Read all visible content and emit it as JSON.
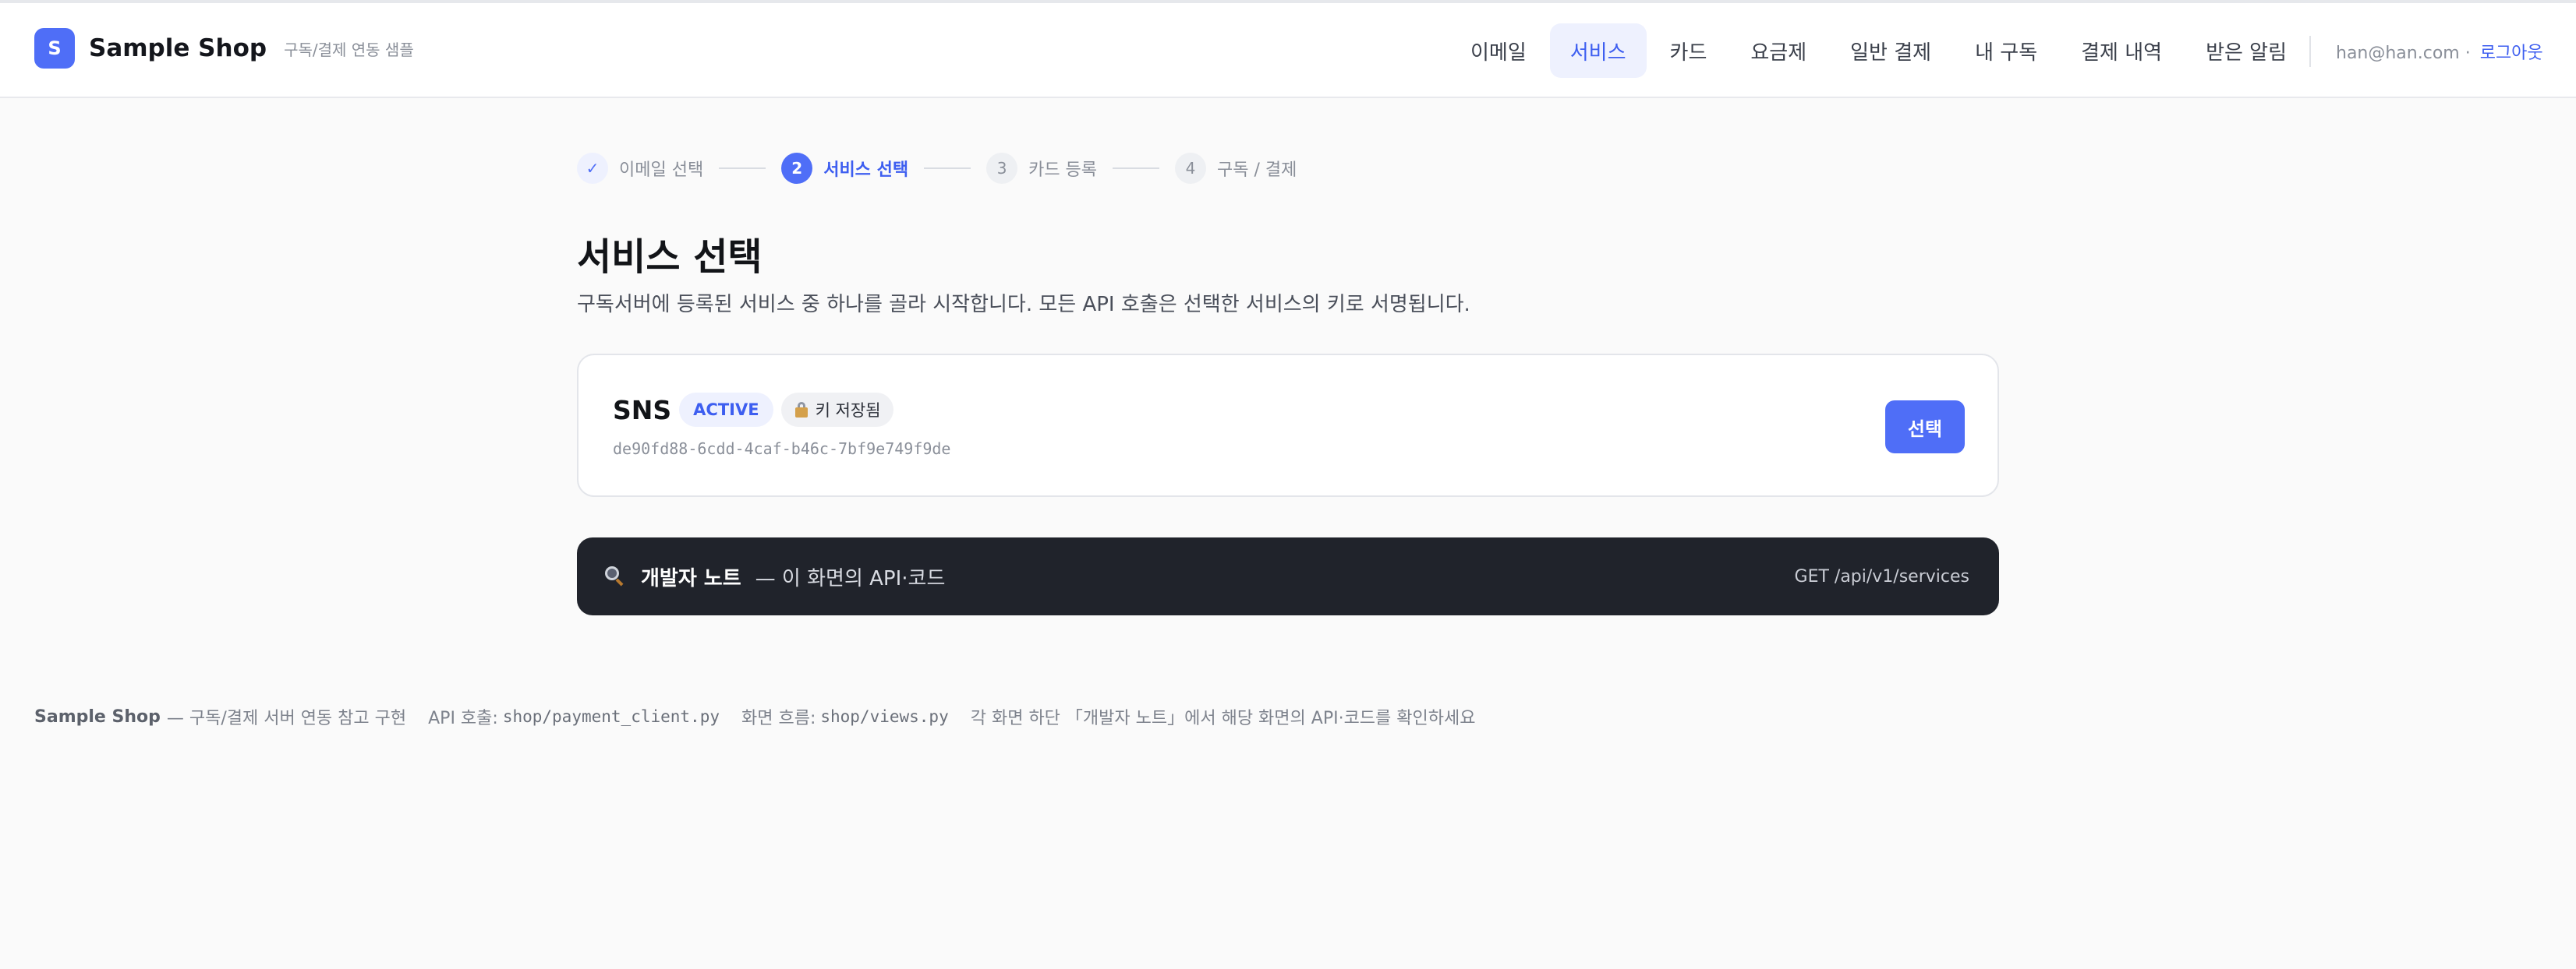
{
  "brand": {
    "logo_letter": "S",
    "name": "Sample Shop",
    "subtitle": "구독/결제 연동 샘플"
  },
  "nav": {
    "items": [
      {
        "label": "이메일"
      },
      {
        "label": "서비스",
        "active": true
      },
      {
        "label": "카드"
      },
      {
        "label": "요금제"
      },
      {
        "label": "일반 결제"
      },
      {
        "label": "내 구독"
      },
      {
        "label": "결제 내역"
      },
      {
        "label": "받은 알림"
      }
    ]
  },
  "user": {
    "email": "han@han.com ·",
    "logout_label": "로그아웃"
  },
  "stepper": {
    "steps": [
      {
        "marker": "✓",
        "label": "이메일 선택",
        "state": "done"
      },
      {
        "marker": "2",
        "label": "서비스 선택",
        "state": "current"
      },
      {
        "marker": "3",
        "label": "카드 등록",
        "state": "pending"
      },
      {
        "marker": "4",
        "label": "구독 / 결제",
        "state": "pending"
      }
    ]
  },
  "page": {
    "title": "서비스 선택",
    "subtitle": "구독서버에 등록된 서비스 중 하나를 골라 시작합니다. 모든 API 호출은 선택한 서비스의 키로 서명됩니다."
  },
  "service_card": {
    "name": "SNS",
    "status_badge": "ACTIVE",
    "key_badge": "키 저장됨",
    "key_icon": "locked-key-icon",
    "uuid": "de90fd88-6cdd-4caf-b46c-7bf9e749f9de",
    "select_label": "선택"
  },
  "dev_note": {
    "icon": "magnifier-icon",
    "title": "개발자 노트",
    "description": "— 이 화면의 API·코드",
    "endpoint": "GET /api/v1/services"
  },
  "footer": {
    "brand": "Sample Shop",
    "brand_desc": "— 구독/결제 서버 연동 참고 구현",
    "api_label": "API 호출:",
    "api_path": "shop/payment_client.py",
    "flow_label": "화면 흐름:",
    "flow_path": "shop/views.py",
    "hint": "각 화면 하단 「개발자 노트」에서 해당 화면의 API·코드를 확인하세요"
  },
  "colors": {
    "accent": "#4f6ef7",
    "dark_panel": "#20232b",
    "background": "#fafafa"
  }
}
